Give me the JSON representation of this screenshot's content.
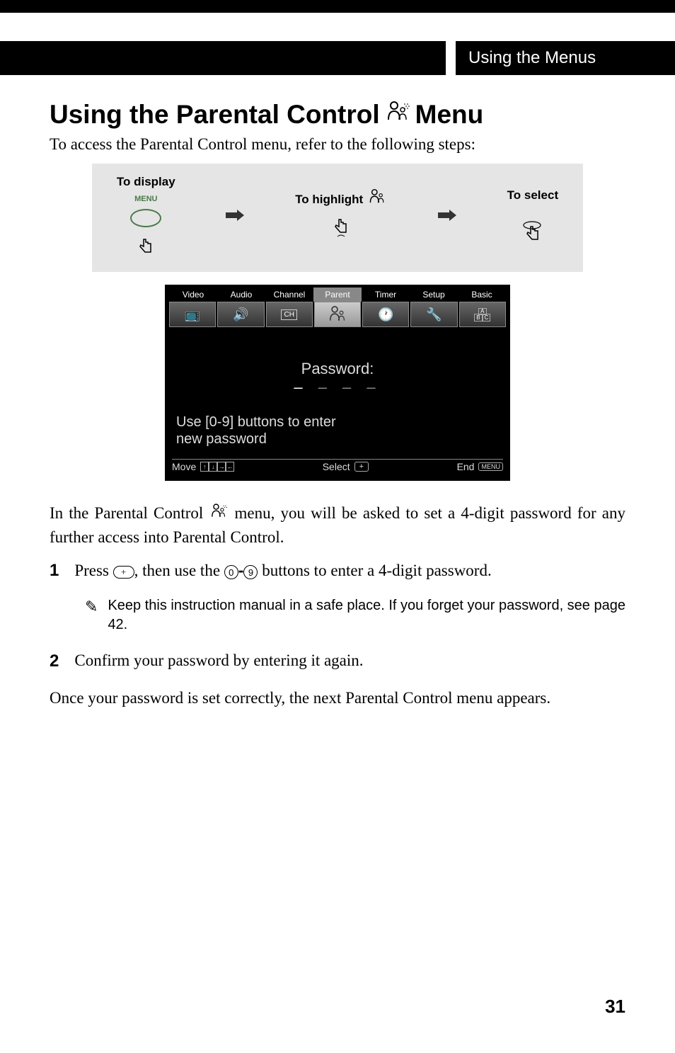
{
  "header": {
    "section_title": "Using the Menus"
  },
  "title_part1": "Using the Parental Control",
  "title_part2": "Menu",
  "intro": "To access the Parental Control menu, refer to the following steps:",
  "graybox": {
    "display_label": "To display",
    "menu_label": "MENU",
    "highlight_label": "To highlight",
    "select_label": "To select"
  },
  "menu_screen": {
    "tabs": [
      "Video",
      "Audio",
      "Channel",
      "Parent",
      "Timer",
      "Setup",
      "Basic"
    ],
    "password_label": "Password:",
    "instruction_line1": "Use [0-9] buttons to enter",
    "instruction_line2": "new password",
    "footer_move": "Move",
    "footer_select": "Select",
    "footer_end": "End",
    "footer_menu_badge": "MENU"
  },
  "body_para_part1": "In the Parental Control ",
  "body_para_part2": " menu, you will be asked to set a 4-digit password for any further access into Parental Control.",
  "step1": {
    "num": "1",
    "text_a": "Press ",
    "text_b": ", then use the ",
    "text_c": " buttons to enter a 4-digit password.",
    "key_dash": "-"
  },
  "note": {
    "text": "Keep this instruction manual in a safe place. If you forget your password, see page 42."
  },
  "step2": {
    "num": "2",
    "text": "Confirm your password by entering it again."
  },
  "closing": "Once your password is set correctly, the next Parental Control menu appears.",
  "page_number": "31"
}
